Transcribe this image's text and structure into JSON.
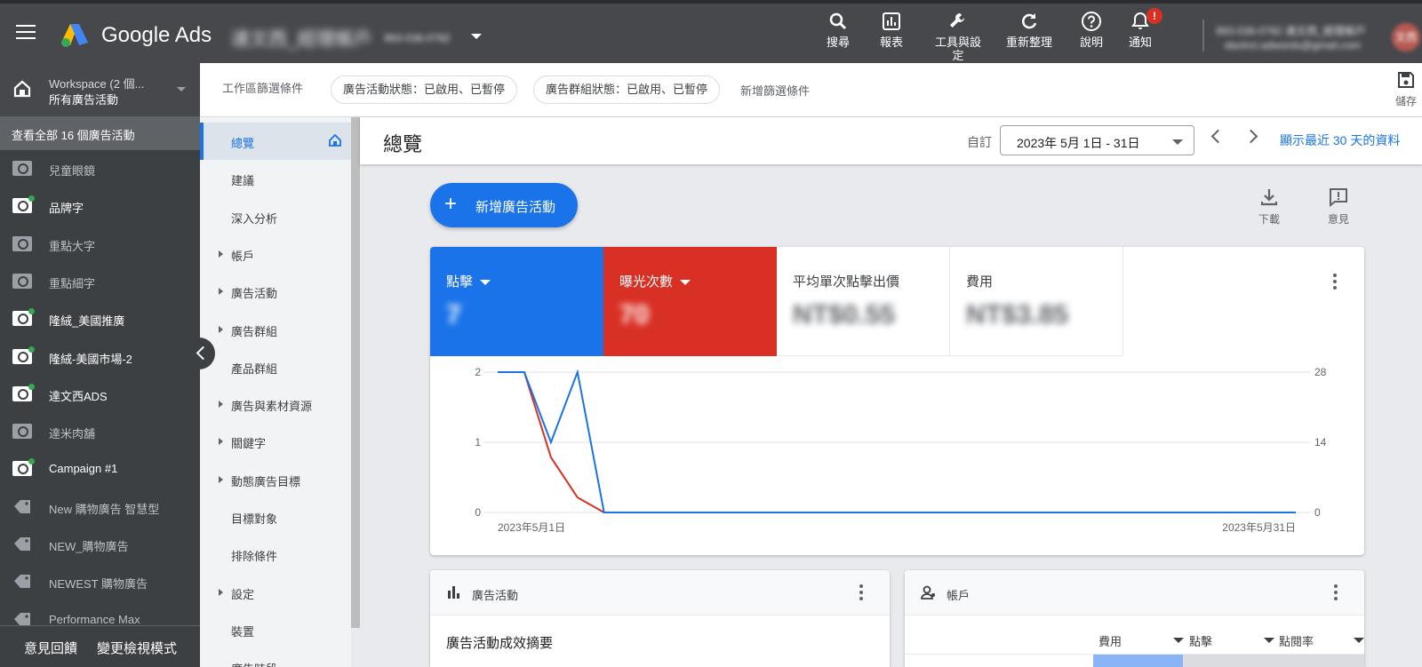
{
  "topbar": {
    "brand": "Google Ads",
    "account_name": "達文西_經理帳戶",
    "account_id": "993-036-0782",
    "tools": [
      {
        "label": "搜尋",
        "icon": "search-icon"
      },
      {
        "label": "報表",
        "icon": "report-icon"
      },
      {
        "label": "工具與設定",
        "icon": "wrench-icon"
      },
      {
        "label": "重新整理",
        "icon": "refresh-icon"
      },
      {
        "label": "說明",
        "icon": "help-icon"
      },
      {
        "label": "通知",
        "icon": "bell-icon",
        "badge": "!"
      }
    ],
    "user_phone": "993-036-0782 達文西_經理帳戶",
    "user_email": "davinci.adwords@gmail.com",
    "avatar_text": "文西"
  },
  "leftnav": {
    "workspace_title": "Workspace (2 個...",
    "workspace_sub": "所有廣告活動",
    "all_campaigns": "查看全部 16 個廣告活動",
    "campaigns": [
      {
        "label": "兒童眼鏡",
        "type": "search-icon",
        "active": false
      },
      {
        "label": "品牌字",
        "type": "search-icon",
        "active": true
      },
      {
        "label": "重點大字",
        "type": "search-icon",
        "active": false
      },
      {
        "label": "重點細字",
        "type": "search-icon",
        "active": false
      },
      {
        "label": "隆絨_美國推廣",
        "type": "search-icon",
        "active": true
      },
      {
        "label": "隆絨-美國市場-2",
        "type": "display-search-icon",
        "active": true
      },
      {
        "label": "達文西ADS",
        "type": "search-icon",
        "active": true
      },
      {
        "label": "達米肉舖",
        "type": "search-icon",
        "active": false
      },
      {
        "label": "Campaign #1",
        "type": "search-icon",
        "active": true
      },
      {
        "label": "New 購物廣告 智慧型",
        "type": "shopping-tag-icon",
        "active": false
      },
      {
        "label": "NEW_購物廣告",
        "type": "shopping-tag-icon",
        "active": false
      },
      {
        "label": "NEWEST 購物廣告",
        "type": "shopping-tag-icon",
        "active": false
      },
      {
        "label": "Performance Max",
        "type": "pmax-icon",
        "active": false
      }
    ],
    "footer_feedback": "意見回饋",
    "footer_view": "變更檢視模式"
  },
  "filterbar": {
    "label": "工作區篩選條件",
    "chips": [
      "廣告活動狀態：已啟用、已暫停",
      "廣告群組狀態：已啟用、已暫停"
    ],
    "add_filter": "新增篩選條件",
    "save": "儲存"
  },
  "pagenav": {
    "items": [
      {
        "label": "總覽",
        "active": true,
        "expandable": false
      },
      {
        "label": "建議",
        "active": false,
        "expandable": false
      },
      {
        "label": "深入分析",
        "active": false,
        "expandable": false
      },
      {
        "label": "帳戶",
        "active": false,
        "expandable": true
      },
      {
        "label": "廣告活動",
        "active": false,
        "expandable": true
      },
      {
        "label": "廣告群組",
        "active": false,
        "expandable": true
      },
      {
        "label": "產品群組",
        "active": false,
        "expandable": false
      },
      {
        "label": "廣告與素材資源",
        "active": false,
        "expandable": true
      },
      {
        "label": "關鍵字",
        "active": false,
        "expandable": true
      },
      {
        "label": "動態廣告目標",
        "active": false,
        "expandable": true
      },
      {
        "label": "目標對象",
        "active": false,
        "expandable": false
      },
      {
        "label": "排除條件",
        "active": false,
        "expandable": false
      },
      {
        "label": "設定",
        "active": false,
        "expandable": true
      },
      {
        "label": "裝置",
        "active": false,
        "expandable": false
      },
      {
        "label": "廣告時段",
        "active": false,
        "expandable": false
      }
    ]
  },
  "main": {
    "title": "總覽",
    "custom_label": "自訂",
    "date_range": "2023年 5月 1日 - 31日",
    "recent_link": "顯示最近 30 天的資料",
    "new_campaign": "新增廣告活動",
    "download": "下載",
    "feedback": "意見"
  },
  "metrics": [
    {
      "label": "點擊",
      "value": "7",
      "color": "#1a73e8",
      "selectable": true
    },
    {
      "label": "曝光次數",
      "value": "70",
      "color": "#d93025",
      "selectable": true
    },
    {
      "label": "平均單次點擊出價",
      "value": "NT$0.55",
      "color": "#ffffff",
      "selectable": false
    },
    {
      "label": "費用",
      "value": "NT$3.85",
      "color": "#ffffff",
      "selectable": false
    }
  ],
  "chart_data": {
    "type": "line",
    "x": [
      "2023-05-01",
      "2023-05-02",
      "2023-05-03",
      "2023-05-04",
      "2023-05-05",
      "2023-05-06",
      "2023-05-07",
      "2023-05-08",
      "2023-05-09",
      "2023-05-10",
      "2023-05-11",
      "2023-05-12",
      "2023-05-13",
      "2023-05-14",
      "2023-05-15",
      "2023-05-16",
      "2023-05-17",
      "2023-05-18",
      "2023-05-19",
      "2023-05-20",
      "2023-05-21",
      "2023-05-22",
      "2023-05-23",
      "2023-05-24",
      "2023-05-25",
      "2023-05-26",
      "2023-05-27",
      "2023-05-28",
      "2023-05-29",
      "2023-05-30",
      "2023-05-31"
    ],
    "x_tick_labels": [
      "2023年5月1日",
      "2023年5月31日"
    ],
    "series": [
      {
        "name": "點擊",
        "axis": "left",
        "color": "#1a73e8",
        "values": [
          2,
          2,
          1,
          2,
          0,
          0,
          0,
          0,
          0,
          0,
          0,
          0,
          0,
          0,
          0,
          0,
          0,
          0,
          0,
          0,
          0,
          0,
          0,
          0,
          0,
          0,
          0,
          0,
          0,
          0,
          0
        ]
      },
      {
        "name": "曝光次數",
        "axis": "right",
        "color": "#d93025",
        "values": [
          28,
          28,
          11,
          3,
          0,
          0,
          0,
          0,
          0,
          0,
          0,
          0,
          0,
          0,
          0,
          0,
          0,
          0,
          0,
          0,
          0,
          0,
          0,
          0,
          0,
          0,
          0,
          0,
          0,
          0,
          0
        ]
      }
    ],
    "y_left": {
      "ticks": [
        "2",
        "1",
        "0"
      ],
      "ylim": [
        0,
        2
      ]
    },
    "y_right": {
      "ticks": [
        "28",
        "14",
        "0"
      ],
      "ylim": [
        0,
        28
      ]
    },
    "grid": true
  },
  "cards": {
    "campaigns_title": "廣告活動",
    "campaigns_summary": "廣告活動成效摘要",
    "accounts_title": "帳戶",
    "account_columns": [
      "費用",
      "點擊",
      "點閱率"
    ]
  }
}
